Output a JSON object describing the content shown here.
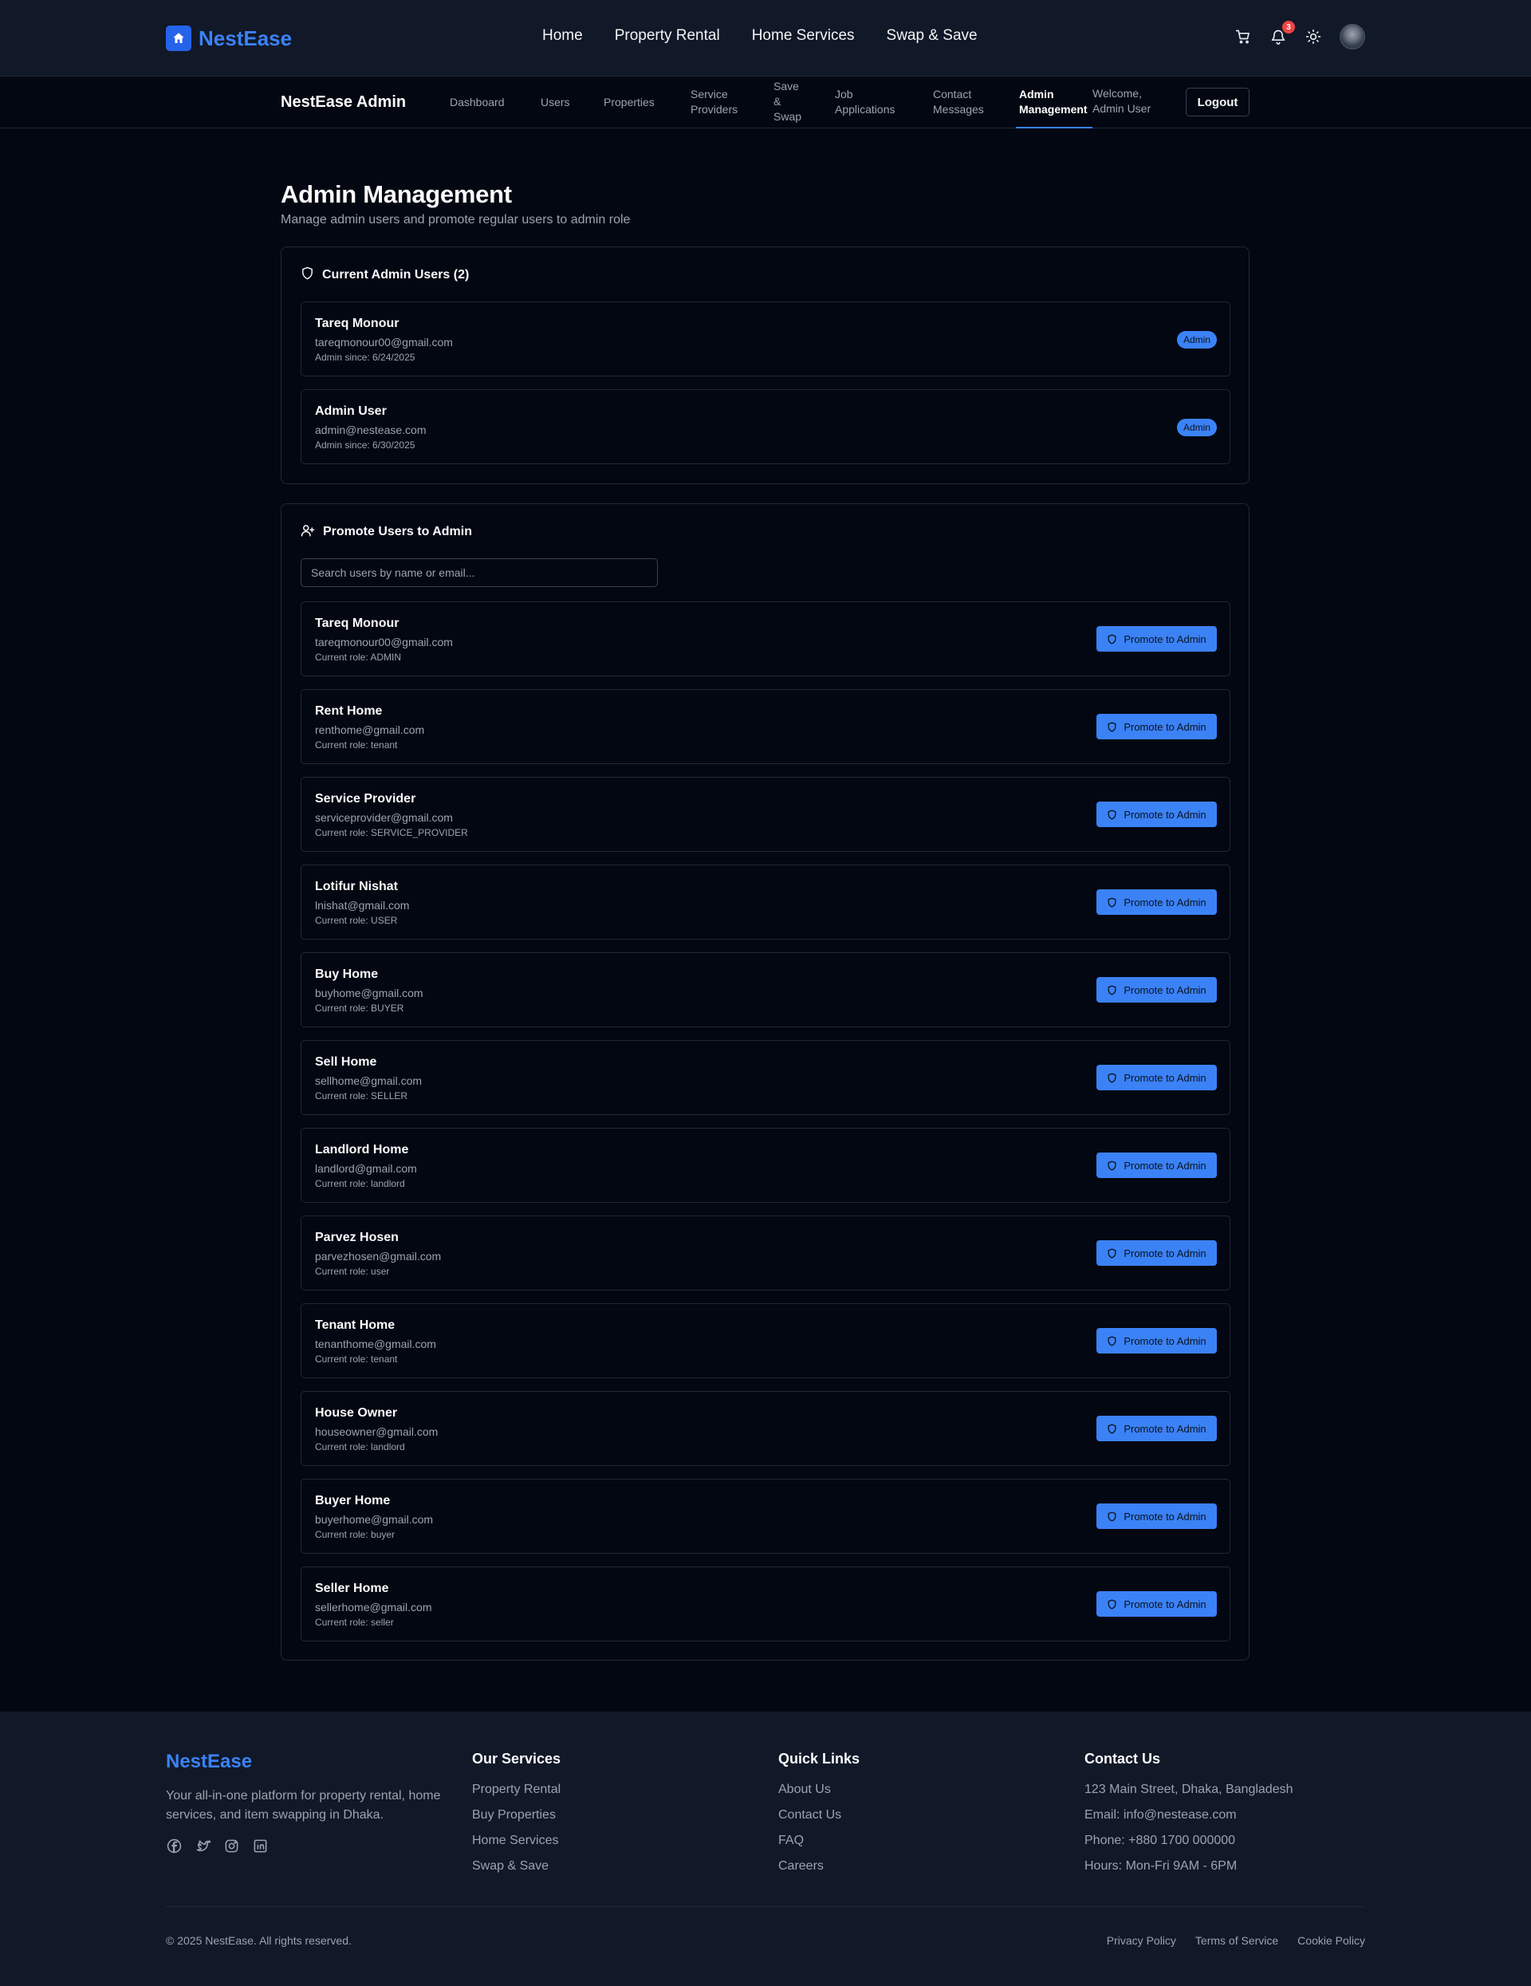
{
  "brand": "NestEase",
  "main_menu": [
    "Home",
    "Property Rental",
    "Home Services",
    "Swap & Save"
  ],
  "notifications_count": "3",
  "icons": {
    "cart": "shopping-cart-icon",
    "bell": "bell-icon",
    "theme": "sun-icon",
    "shield": "shield-icon",
    "user_plus": "user-plus-icon"
  },
  "colors": {
    "accent": "#3b82f6",
    "background": "#030712",
    "surface": "#111827",
    "badge_red": "#ef4444"
  },
  "admin_nav": {
    "brand": "NestEase Admin",
    "tabs": [
      "Dashboard",
      "Users",
      "Properties",
      "Service Providers",
      "Save & Swap",
      "Job Applications",
      "Contact Messages",
      "Admin Management"
    ],
    "active_tab": "Admin Management",
    "welcome": "Welcome, Admin User",
    "logout": "Logout"
  },
  "page": {
    "title": "Admin Management",
    "subtitle": "Manage admin users and promote regular users to admin role"
  },
  "current_admins": {
    "title": "Current Admin Users (2)",
    "badge": "Admin",
    "items": [
      {
        "name": "Tareq Monour",
        "email": "tareqmonour00@gmail.com",
        "since": "Admin since: 6/24/2025"
      },
      {
        "name": "Admin User",
        "email": "admin@nestease.com",
        "since": "Admin since: 6/30/2025"
      }
    ]
  },
  "promote": {
    "title": "Promote Users to Admin",
    "search_placeholder": "Search users by name or email...",
    "button_label": "Promote to Admin",
    "users": [
      {
        "name": "Tareq Monour",
        "email": "tareqmonour00@gmail.com",
        "role": "Current role: ADMIN"
      },
      {
        "name": "Rent Home",
        "email": "renthome@gmail.com",
        "role": "Current role: tenant"
      },
      {
        "name": "Service Provider",
        "email": "serviceprovider@gmail.com",
        "role": "Current role: SERVICE_PROVIDER"
      },
      {
        "name": "Lotifur Nishat",
        "email": "lnishat@gmail.com",
        "role": "Current role: USER"
      },
      {
        "name": "Buy Home",
        "email": "buyhome@gmail.com",
        "role": "Current role: BUYER"
      },
      {
        "name": "Sell Home",
        "email": "sellhome@gmail.com",
        "role": "Current role: SELLER"
      },
      {
        "name": "Landlord Home",
        "email": "landlord@gmail.com",
        "role": "Current role: landlord"
      },
      {
        "name": "Parvez Hosen",
        "email": "parvezhosen@gmail.com",
        "role": "Current role: user"
      },
      {
        "name": "Tenant Home",
        "email": "tenanthome@gmail.com",
        "role": "Current role: tenant"
      },
      {
        "name": "House Owner",
        "email": "houseowner@gmail.com",
        "role": "Current role: landlord"
      },
      {
        "name": "Buyer Home",
        "email": "buyerhome@gmail.com",
        "role": "Current role: buyer"
      },
      {
        "name": "Seller Home",
        "email": "sellerhome@gmail.com",
        "role": "Current role: seller"
      }
    ]
  },
  "footer": {
    "brand": "NestEase",
    "description": "Your all-in-one platform for property rental, home services, and item swapping in Dhaka.",
    "social_icons": [
      "facebook-icon",
      "twitter-icon",
      "instagram-icon",
      "linkedin-icon"
    ],
    "services": {
      "title": "Our Services",
      "links": [
        "Property Rental",
        "Buy Properties",
        "Home Services",
        "Swap & Save"
      ]
    },
    "quick_links": {
      "title": "Quick Links",
      "links": [
        "About Us",
        "Contact Us",
        "FAQ",
        "Careers"
      ]
    },
    "contact": {
      "title": "Contact Us",
      "lines": [
        "123 Main Street, Dhaka, Bangladesh",
        "Email: info@nestease.com",
        "Phone: +880 1700 000000",
        "Hours: Mon-Fri 9AM - 6PM"
      ]
    },
    "copyright": "© 2025 NestEase. All rights reserved.",
    "legal": [
      "Privacy Policy",
      "Terms of Service",
      "Cookie Policy"
    ]
  }
}
